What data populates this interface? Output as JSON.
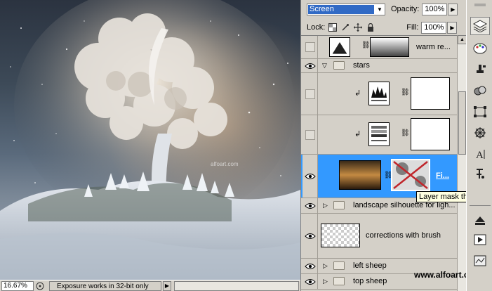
{
  "layers_panel": {
    "blend_mode": "Screen",
    "opacity_label": "Opacity:",
    "opacity_value": "100%",
    "lock_label": "Lock:",
    "fill_label": "Fill:",
    "fill_value": "100%",
    "layers": [
      {
        "name": "warm re...",
        "kind": "adjustment"
      },
      {
        "name": "stars",
        "kind": "group-open"
      },
      {
        "name": "",
        "kind": "adjustment-clipped-levels"
      },
      {
        "name": "",
        "kind": "adjustment-clipped-gradient"
      },
      {
        "name": "Fi...",
        "kind": "masked-selected"
      },
      {
        "name": "landscape silhouette for ligh...",
        "kind": "group"
      },
      {
        "name": "corrections with brush",
        "kind": "pixel"
      },
      {
        "name": "left sheep",
        "kind": "group"
      },
      {
        "name": "top sheep",
        "kind": "group"
      }
    ],
    "tooltip": "Layer mask thumbn"
  },
  "status_bar": {
    "zoom": "16.67%",
    "message": "Exposure works in 32-bit only"
  },
  "canvas": {
    "watermark": "alfoart.com"
  },
  "site_watermark": "www.alfoart.com",
  "toolbar": {
    "tools": [
      "layers-icon",
      "brush-palette-icon",
      "clone-source-icon",
      "paths-icon",
      "transform-icon",
      "navigator-icon",
      "character-icon",
      "paragraph-icon",
      "actions-icon",
      "play-icon",
      "info-icon"
    ]
  },
  "colors": {
    "selection": "#3399ff",
    "panel": "#d4d0c8",
    "mask_cross": "#c0262b"
  }
}
